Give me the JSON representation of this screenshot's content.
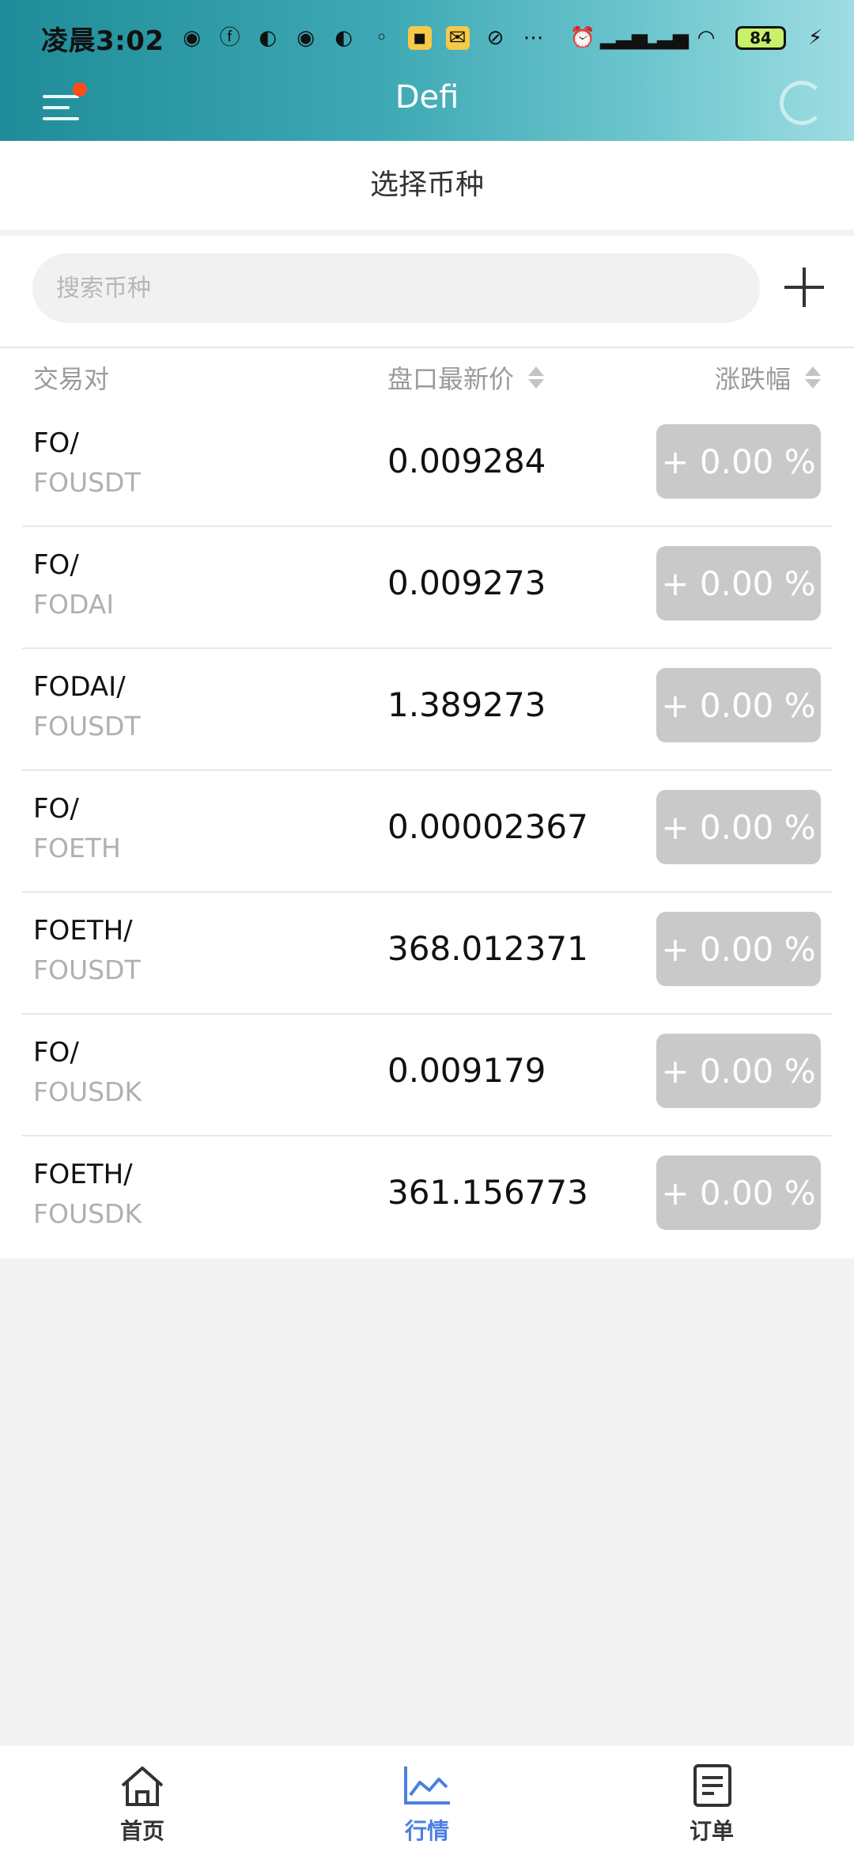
{
  "status_bar": {
    "time": "凌晨3:02",
    "battery": "84"
  },
  "header": {
    "title": "Defi"
  },
  "section": {
    "title": "选择币种"
  },
  "search": {
    "placeholder": "搜索币种"
  },
  "table": {
    "columns": {
      "pair": "交易对",
      "price": "盘口最新价",
      "change": "涨跌幅"
    },
    "rows": [
      {
        "base": "FO/",
        "quote": "FOUSDT",
        "price": "0.009284",
        "change": "+ 0.00 %"
      },
      {
        "base": "FO/",
        "quote": "FODAI",
        "price": "0.009273",
        "change": "+ 0.00 %"
      },
      {
        "base": "FODAI/",
        "quote": "FOUSDT",
        "price": "1.389273",
        "change": "+ 0.00 %"
      },
      {
        "base": "FO/",
        "quote": "FOETH",
        "price": "0.00002367",
        "change": "+ 0.00 %"
      },
      {
        "base": "FOETH/",
        "quote": "FOUSDT",
        "price": "368.012371",
        "change": "+ 0.00 %"
      },
      {
        "base": "FO/",
        "quote": "FOUSDK",
        "price": "0.009179",
        "change": "+ 0.00 %"
      },
      {
        "base": "FOETH/",
        "quote": "FOUSDK",
        "price": "361.156773",
        "change": "+ 0.00 %"
      }
    ]
  },
  "bottom_nav": {
    "items": [
      {
        "label": "首页",
        "icon": "home-icon"
      },
      {
        "label": "行情",
        "icon": "chart-icon",
        "active": true
      },
      {
        "label": "订单",
        "icon": "document-icon"
      }
    ]
  },
  "colors": {
    "header_gradient_start": "#1f8c99",
    "header_gradient_end": "#9edde2",
    "active_tab": "#4a7fe0",
    "change_badge": "#c9c9c9",
    "notification_dot": "#ff4d1a"
  }
}
